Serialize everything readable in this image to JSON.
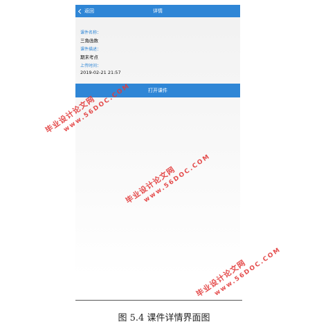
{
  "header": {
    "back_label": "返回",
    "title": "详情"
  },
  "details": {
    "name_label": "课件名称：",
    "name_value": "三角函数",
    "desc_label": "课件描述：",
    "desc_value": "期末考点",
    "time_label": "上传时间：",
    "time_value": "2019-02-21 21:57"
  },
  "actions": {
    "open_label": "打开课件"
  },
  "caption": "图 5.4 课件详情界面图",
  "watermark": {
    "text": "毕业设计论文网",
    "url": "www.56DOC.COM"
  },
  "colors": {
    "accent": "#2f86d6",
    "watermark": "#e23a3a"
  }
}
